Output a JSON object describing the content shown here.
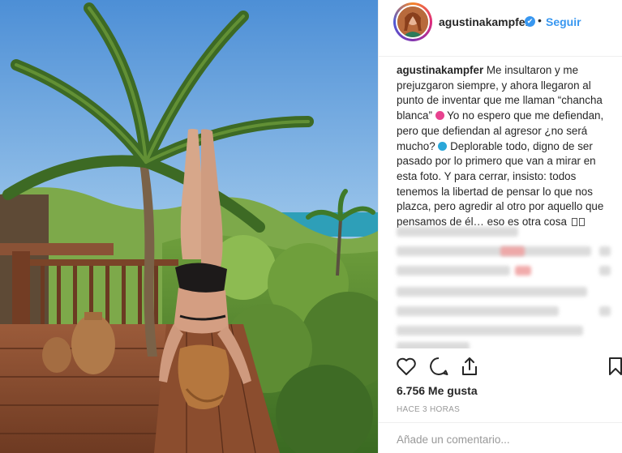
{
  "post": {
    "username": "agustinakampfer",
    "verified_mark": "✔",
    "separator": "•",
    "follow_label": "Seguir",
    "caption_lines": [
      "Me insultaron y me",
      "prejuzgaron siempre, y ahora llegaron al",
      "punto de inventar que me llaman “chancha",
      "blanca”",
      "Yo no espero que me defiendan,",
      "pero que defiendan al agresor ¿no será",
      "mucho?",
      "Deplorable todo, digno de ser",
      "pasado por lo primero que van a mirar en",
      "esta foto. Y para cerrar, insisto: todos",
      "tenemos la libertad de pensar lo que nos",
      "plazca, pero agredir al otro por aquello que",
      "pensamos de él… eso es otra cosa"
    ],
    "likes": "6.756 Me gusta",
    "time_ago": "HACE 3 HORAS",
    "comment_placeholder": "Añade un comentario..."
  },
  "icons": {
    "like": "heart-icon",
    "comment": "comment-bubble-icon",
    "share": "share-icon",
    "save": "bookmark-icon",
    "verified": "verified-badge-icon"
  },
  "colors": {
    "link_blue": "#3897f0",
    "text": "#262626",
    "muted": "#999999",
    "divider": "#efefef"
  }
}
